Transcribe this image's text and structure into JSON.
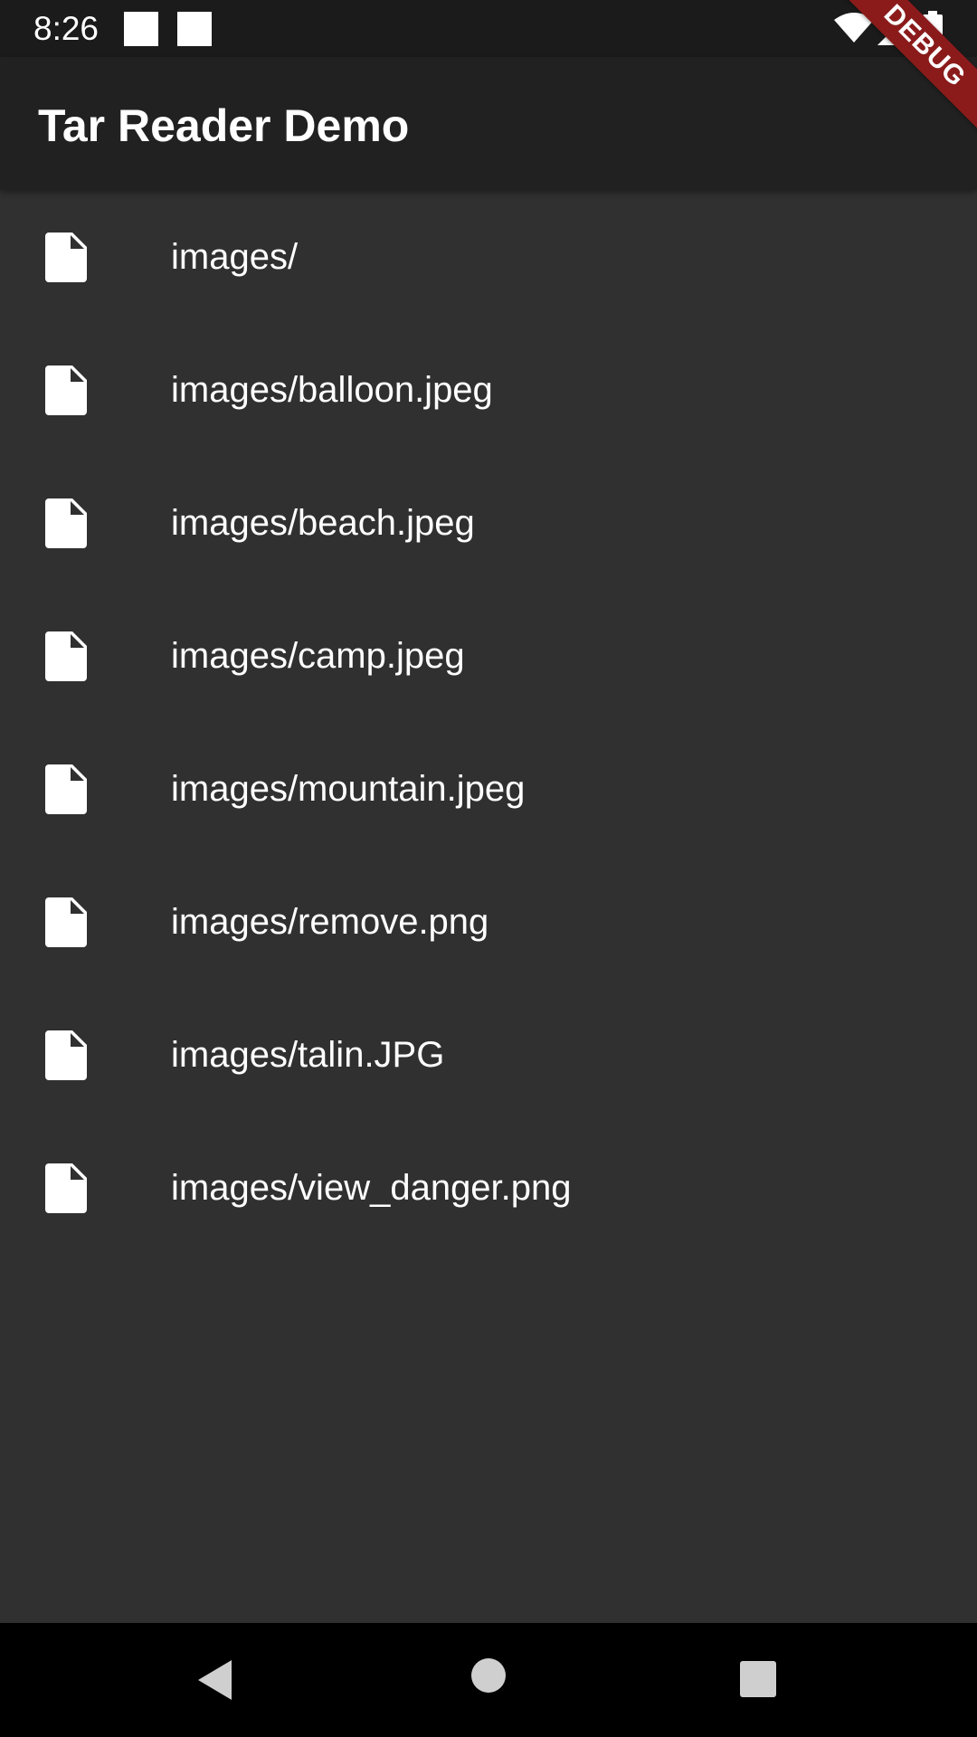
{
  "status_bar": {
    "time": "8:26",
    "icons": [
      "notification-square-icon",
      "notification-square-icon",
      "wifi-icon",
      "cell-signal-icon",
      "battery-icon"
    ]
  },
  "app_bar": {
    "title": "Tar Reader Demo"
  },
  "debug_banner": {
    "label": "DEBUG",
    "color": "#8b1b1b"
  },
  "files": [
    {
      "name": "images/",
      "icon": "file-icon"
    },
    {
      "name": "images/balloon.jpeg",
      "icon": "file-icon"
    },
    {
      "name": "images/beach.jpeg",
      "icon": "file-icon"
    },
    {
      "name": "images/camp.jpeg",
      "icon": "file-icon"
    },
    {
      "name": "images/mountain.jpeg",
      "icon": "file-icon"
    },
    {
      "name": "images/remove.png",
      "icon": "file-icon"
    },
    {
      "name": "images/talin.JPG",
      "icon": "file-icon"
    },
    {
      "name": "images/view_danger.png",
      "icon": "file-icon"
    }
  ],
  "nav_bar": {
    "buttons": [
      "back-icon",
      "home-icon",
      "recents-icon"
    ]
  },
  "colors": {
    "background": "#303030",
    "app_bar": "#212121",
    "status_bar": "#1b1b1b",
    "text": "#ffffff"
  }
}
